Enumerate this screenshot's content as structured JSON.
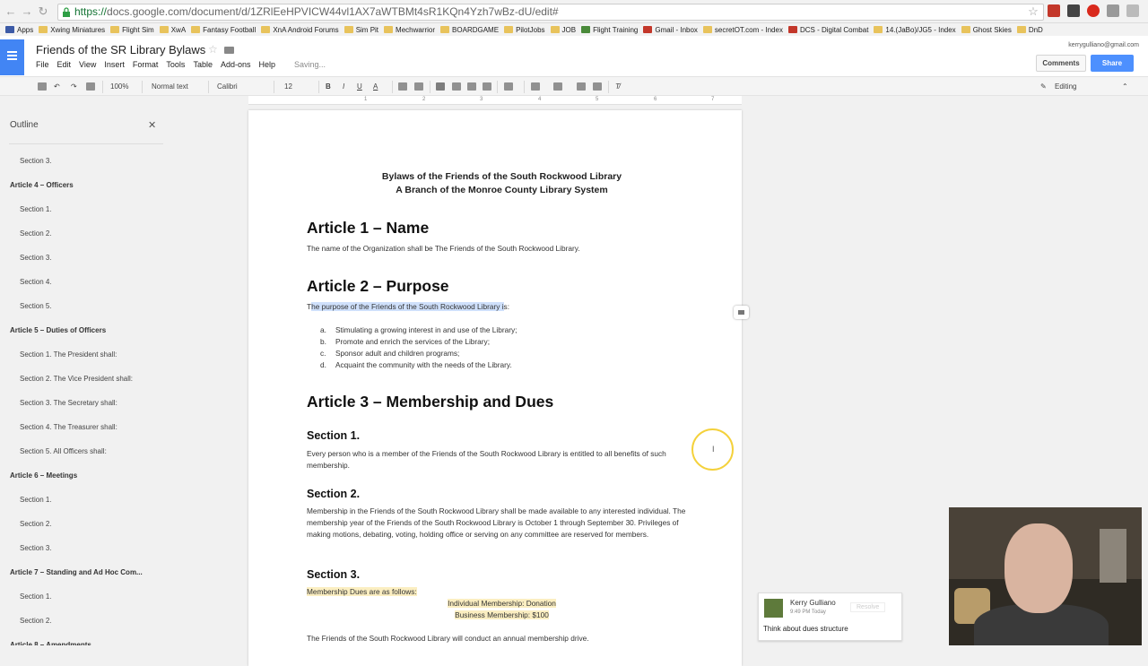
{
  "browser": {
    "url_scheme": "https://",
    "url_rest": "docs.google.com/document/d/1ZRlEeHPVICW44vl1AX7aWTBMt4sR1KQn4Yzh7wBz-dU/edit#",
    "bookmarks": [
      "Apps",
      "Xwing Miniatures",
      "Flight Sim",
      "XwA",
      "Fantasy Football",
      "XnA Android Forums",
      "Sim Pit",
      "Mechwarrior",
      "BOARDGAME",
      "PilotJobs",
      "JOB",
      "Flight Training",
      "Gmail - Inbox",
      "secretOT.com - Index",
      "DCS - Digital Combat",
      "14.(JaBo)/JG5 - Index",
      "Ghost Skies",
      "DnD"
    ]
  },
  "docs": {
    "title": "Friends of the SR Library Bylaws",
    "menu": [
      "File",
      "Edit",
      "View",
      "Insert",
      "Format",
      "Tools",
      "Table",
      "Add-ons",
      "Help"
    ],
    "saving": "Saving...",
    "account": "kerrygulliano@gmail.com",
    "comments_btn": "Comments",
    "share_btn": "Share",
    "toolbar": {
      "zoom": "100%",
      "style": "Normal text",
      "font": "Calibri",
      "size": "12",
      "bold": "B",
      "italic": "I",
      "underline": "U",
      "color": "A",
      "mode": "Editing"
    }
  },
  "ruler": [
    "1",
    "2",
    "3",
    "4",
    "5",
    "6",
    "7"
  ],
  "outline": {
    "title": "Outline",
    "items": [
      {
        "t": "Section 3.",
        "k": "sec"
      },
      {
        "t": "Article 4 – Officers",
        "k": "art"
      },
      {
        "t": "Section 1.",
        "k": "sec"
      },
      {
        "t": "Section 2.",
        "k": "sec"
      },
      {
        "t": "Section 3.",
        "k": "sec"
      },
      {
        "t": "Section 4.",
        "k": "sec"
      },
      {
        "t": "Section 5.",
        "k": "sec"
      },
      {
        "t": "Article 5 – Duties of Officers",
        "k": "art"
      },
      {
        "t": "Section 1. The President shall:",
        "k": "sec"
      },
      {
        "t": "Section 2.  The Vice President shall:",
        "k": "sec"
      },
      {
        "t": "Section 3.  The Secretary shall:",
        "k": "sec"
      },
      {
        "t": "Section 4. The Treasurer shall:",
        "k": "sec"
      },
      {
        "t": "Section 5. All Officers shall:",
        "k": "sec"
      },
      {
        "t": "Article 6 – Meetings",
        "k": "art"
      },
      {
        "t": "Section 1.",
        "k": "sec"
      },
      {
        "t": "Section 2.",
        "k": "sec"
      },
      {
        "t": "Section 3.",
        "k": "sec"
      },
      {
        "t": "Article 7 – Standing and Ad Hoc Com...",
        "k": "art"
      },
      {
        "t": "Section 1.",
        "k": "sec"
      },
      {
        "t": "Section 2.",
        "k": "sec"
      },
      {
        "t": "Article 8 – Amendments",
        "k": "art"
      }
    ]
  },
  "document": {
    "title1": "Bylaws of the Friends of the South Rockwood Library",
    "title2": "A Branch of the Monroe County Library System",
    "art1": "Article 1 – Name",
    "art1_text": "The name of the Organization shall be The Friends of the South Rockwood Library.",
    "art2": "Article 2 – Purpose",
    "art2_t": "T",
    "art2_hl": "he purpose of the Friends of the South Rockwood Library i",
    "art2_end": "s:",
    "purpose_list": [
      {
        "m": "a.",
        "t": "Stimulating a growing interest in and use of the Library;"
      },
      {
        "m": "b.",
        "t": "Promote and enrich the services of the Library;"
      },
      {
        "m": "c.",
        "t": "Sponsor adult and children programs;"
      },
      {
        "m": "d.",
        "t": "Acquaint the community with the needs of the Library."
      }
    ],
    "art3": "Article 3 – Membership and Dues",
    "s1": "Section 1.",
    "s1_text": "Every person who is a member of the Friends of the South Rockwood Library is entitled to all benefits of such membership.",
    "s2": "Section 2.",
    "s2_text": "Membership in the Friends of the South Rockwood Library shall be made available to any interested individual. The membership year of the Friends of the South Rockwood Library is October 1 through September 30. Privileges of making motions, debating, voting, holding office or serving on any committee are reserved for members.",
    "s3": "Section 3.",
    "dues_intro": "Membership Dues are as follows:",
    "dues_ind": "Individual Membership: Donation",
    "dues_bus": "Business Membership: $100",
    "drive": "The Friends of the South Rockwood Library will conduct an annual membership drive."
  },
  "comment": {
    "author": "Kerry Gulliano",
    "time": "9:49 PM Today",
    "resolve": "Resolve",
    "text": "Think about dues structure"
  }
}
